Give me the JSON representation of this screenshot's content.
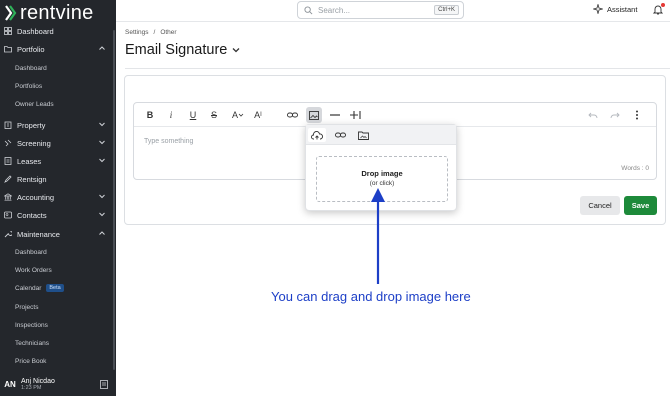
{
  "app": {
    "logo_text": "rentvine"
  },
  "sidebar": {
    "items": [
      {
        "label": "Dashboard"
      },
      {
        "label": "Portfolio"
      },
      {
        "label": "Property"
      },
      {
        "label": "Screening"
      },
      {
        "label": "Leases"
      },
      {
        "label": "Rentsign"
      },
      {
        "label": "Accounting"
      },
      {
        "label": "Contacts"
      },
      {
        "label": "Maintenance"
      }
    ],
    "portfolio_sub": [
      "Dashboard",
      "Portfolios",
      "Owner Leads"
    ],
    "maintenance_sub": [
      "Dashboard",
      "Work Orders",
      "Calendar",
      "Projects",
      "Inspections",
      "Technicians",
      "Price Book"
    ],
    "calendar_badge": "Beta"
  },
  "user": {
    "initials": "AN",
    "name": "Anj Nicdao",
    "time": "1:23 PM"
  },
  "topbar": {
    "search_placeholder": "Search...",
    "search_shortcut": "Ctrl+K",
    "assistant_label": "Assistant"
  },
  "breadcrumb": {
    "level1": "Settings",
    "separator": "/",
    "level2": "Other"
  },
  "page": {
    "title": "Email Signature"
  },
  "editor": {
    "placeholder": "Type something",
    "word_count": "Words : 0",
    "toolbar": {
      "bold": "B",
      "italic": "i",
      "underline": "U",
      "strike": "S",
      "font_color": "A",
      "font_size": "A"
    }
  },
  "image_popup": {
    "drop_title": "Drop image",
    "drop_subtitle": "(or click)"
  },
  "buttons": {
    "cancel": "Cancel",
    "save": "Save"
  },
  "annotation": {
    "text": "You can drag and drop image here",
    "color": "#1d3fc7"
  },
  "colors": {
    "sidebar_bg": "#24272c",
    "save_green": "#1d8a3a",
    "logo_accent": "#2fb25a"
  }
}
